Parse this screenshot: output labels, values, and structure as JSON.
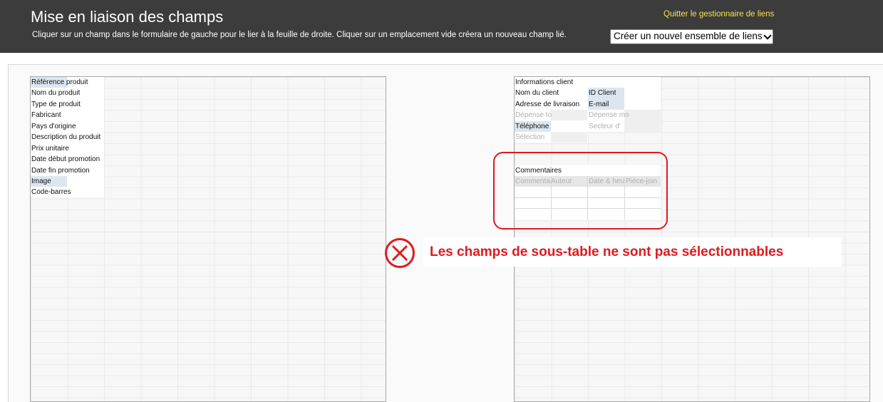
{
  "header": {
    "title": "Mise en liaison des champs",
    "subtitle": "Cliquer sur un champ dans le formulaire de gauche pour le lier à la feuille de droite. Cliquer sur un emplacement vide créera un nouveau champ lié.",
    "quit_link": "Quitter le gestionnaire de liens",
    "link_set_select": "Créer un nouvel ensemble de liens"
  },
  "left_form": {
    "fields": [
      "Référence produit",
      "Nom du produit",
      "Type de produit",
      "Fabricant",
      "Pays d'origine",
      "Description du produit",
      "Prix unitaire",
      "Date début promotion",
      "Date fin promotion",
      "Image",
      "Code-barres"
    ]
  },
  "right_sheet": {
    "section_title": "Informations client",
    "fields": {
      "nom_client": "Nom du client",
      "id_client": "ID Client",
      "adresse": "Adresse de livraison",
      "email": "E-mail",
      "depense_totale": "Dépense to",
      "depense_mo": "Dépense mo",
      "telephone": "Téléphone",
      "secteur": "Secteur d'",
      "selection": "Sélection"
    },
    "subtable": {
      "title": "Commentaires",
      "columns": [
        "Commenta",
        "Auteur",
        "Date & heu",
        "Pièce-join"
      ]
    }
  },
  "warning": {
    "message": "Les champs de sous-table ne sont pas sélectionnables",
    "icon": "cross-circle-icon",
    "color": "#e0191f"
  }
}
